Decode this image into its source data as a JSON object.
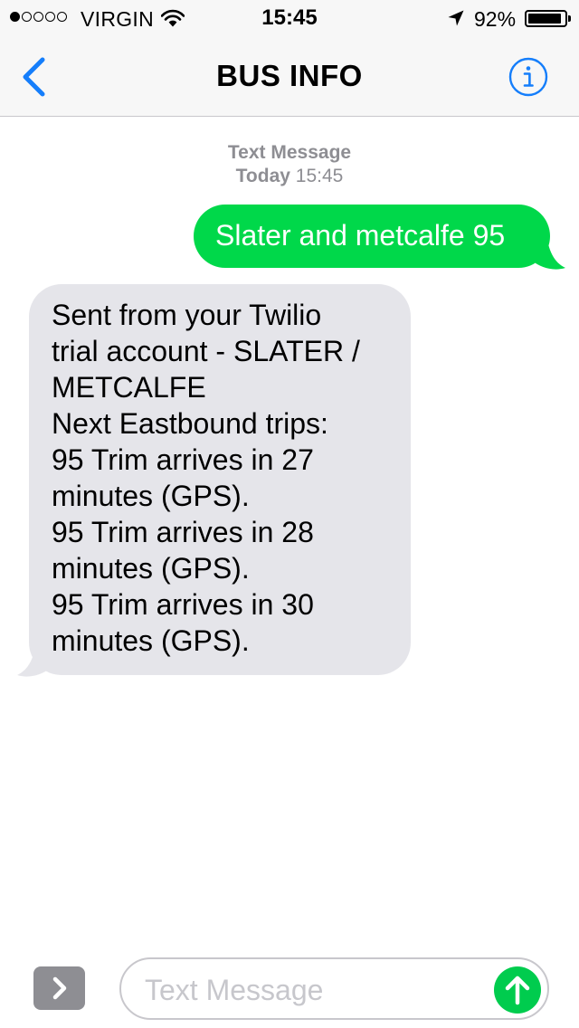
{
  "status_bar": {
    "signal_strength": 1,
    "signal_total": 5,
    "carrier": "VIRGIN",
    "time": "15:45",
    "battery_percent": "92%",
    "battery_level": 0.92
  },
  "nav": {
    "title": "BUS INFO",
    "back_icon": "chevron-left-icon",
    "info_icon": "info-circle-icon",
    "accent_color": "#157efb"
  },
  "conversation": {
    "header_label": "Text Message",
    "header_day": "Today",
    "header_time": "15:45",
    "messages": [
      {
        "direction": "outgoing",
        "color": "#00d84a",
        "lines": [
          "Slater and metcalfe 95"
        ]
      },
      {
        "direction": "incoming",
        "color": "#e5e5ea",
        "lines": [
          "Sent from your Twilio",
          "trial account - SLATER /",
          "METCALFE",
          "Next Eastbound trips:",
          "95 Trim arrives in 27",
          "minutes (GPS).",
          "95 Trim arrives in 28",
          "minutes (GPS).",
          "95 Trim arrives in 30",
          "minutes (GPS)."
        ]
      }
    ]
  },
  "composer": {
    "apps_icon": "chevron-right-icon",
    "placeholder": "Text Message",
    "send_icon": "arrow-up-icon",
    "send_color": "#00cc4e"
  }
}
